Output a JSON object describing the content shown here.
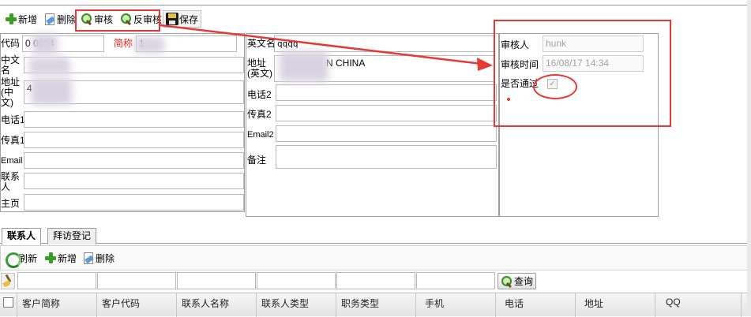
{
  "toolbar": {
    "add": "新增",
    "delete": "删除",
    "audit": "审核",
    "unaudit": "反审核",
    "save": "保存"
  },
  "form_left": {
    "code_label": "代码",
    "code_value": "0        0004",
    "short_label": "简称",
    "short_value": "1",
    "cn_name_label": "中文名",
    "cn_name_value": "",
    "cn_addr_label": "地址(中文)",
    "cn_addr_value": "4",
    "phone1_label": "电话1",
    "fax1_label": "传真1",
    "email_label": "Email",
    "contact_label": "联系人",
    "homepage_label": "主页"
  },
  "form_mid": {
    "en_name_label": "英文名",
    "en_name_value": "qqqq",
    "en_addr_label": "地址(英文)",
    "en_addr_value": "N CHINA",
    "phone2_label": "电话2",
    "fax2_label": "传真2",
    "email2_label": "Email2",
    "remark_label": "备注"
  },
  "audit_panel": {
    "auditor_label": "审核人",
    "auditor_value": "hunk",
    "audit_time_label": "审核时间",
    "audit_time_value": "16/08/17 14:34",
    "passed_label": "是否通过",
    "passed_checked": true
  },
  "tabs": [
    {
      "label": "联系人",
      "active": true
    },
    {
      "label": "拜访登记",
      "active": false
    }
  ],
  "subtoolbar": {
    "refresh": "刷新",
    "add": "新增",
    "delete": "删除",
    "query": "查询"
  },
  "grid": {
    "columns": [
      "客户简称",
      "客户代码",
      "联系人名称",
      "联系人类型",
      "职务类型",
      "手机",
      "电话",
      "地址",
      "QQ"
    ]
  },
  "colors": {
    "highlight_red": "#e53935",
    "short_name_label": "#e11d1d"
  }
}
